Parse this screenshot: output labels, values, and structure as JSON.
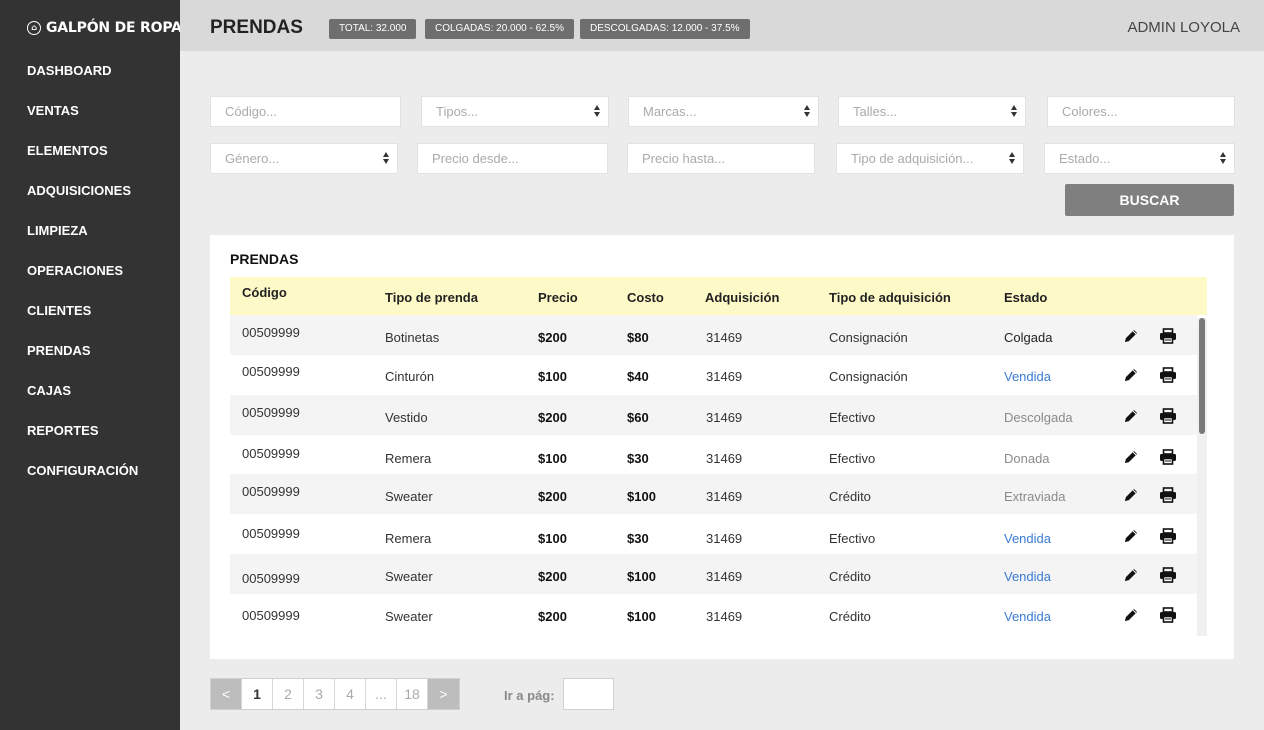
{
  "brand": {
    "name": "GALPÓN DE ROPA",
    "icon": "hanger-logo-icon"
  },
  "sidebar": {
    "items": [
      {
        "label": "DASHBOARD"
      },
      {
        "label": "VENTAS"
      },
      {
        "label": "ELEMENTOS"
      },
      {
        "label": "ADQUISICIONES"
      },
      {
        "label": "LIMPIEZA"
      },
      {
        "label": "OPERACIONES"
      },
      {
        "label": "CLIENTES"
      },
      {
        "label": "PRENDAS"
      },
      {
        "label": "CAJAS"
      },
      {
        "label": "REPORTES"
      },
      {
        "label": "CONFIGURACIÓN"
      }
    ]
  },
  "header": {
    "title": "PRENDAS",
    "badges": [
      "TOTAL: 32.000",
      "COLGADAS: 20.000 - 62.5%",
      "DESCOLGADAS: 12.000 - 37.5%"
    ],
    "user": "ADMIN LOYOLA"
  },
  "filters": {
    "codigo": "Código...",
    "tipos": "Tipos...",
    "marcas": "Marcas...",
    "talles": "Talles...",
    "colores": "Colores...",
    "genero": "Género...",
    "precio_desde": "Precio desde...",
    "precio_hasta": "Precio hasta...",
    "tipo_adquisicion": "Tipo de adquisición...",
    "estado": "Estado...",
    "buscar": "BUSCAR"
  },
  "table": {
    "title": "PRENDAS",
    "columns": [
      "Código",
      "Tipo de prenda",
      "Precio",
      "Costo",
      "Adquisición",
      "Tipo de adquisición",
      "Estado"
    ],
    "rows": [
      {
        "codigo": "00509999",
        "tipo": "Botinetas",
        "precio": "$200",
        "costo": "$80",
        "adquisicion": "31469",
        "tipo_adq": "Consignación",
        "estado": "Colgada",
        "estado_style": "neutral"
      },
      {
        "codigo": "00509999",
        "tipo": "Cinturón",
        "precio": "$100",
        "costo": "$40",
        "adquisicion": "31469",
        "tipo_adq": "Consignación",
        "estado": "Vendida",
        "estado_style": "link"
      },
      {
        "codigo": "00509999",
        "tipo": "Vestido",
        "precio": "$200",
        "costo": "$60",
        "adquisicion": "31469",
        "tipo_adq": "Efectivo",
        "estado": "Descolgada",
        "estado_style": "muted"
      },
      {
        "codigo": "00509999",
        "tipo": "Remera",
        "precio": "$100",
        "costo": "$30",
        "adquisicion": "31469",
        "tipo_adq": "Efectivo",
        "estado": "Donada",
        "estado_style": "muted"
      },
      {
        "codigo": "00509999",
        "tipo": "Sweater",
        "precio": "$200",
        "costo": "$100",
        "adquisicion": "31469",
        "tipo_adq": "Crédito",
        "estado": "Extraviada",
        "estado_style": "muted"
      },
      {
        "codigo": "00509999",
        "tipo": "Remera",
        "precio": "$100",
        "costo": "$30",
        "adquisicion": "31469",
        "tipo_adq": "Efectivo",
        "estado": "Vendida",
        "estado_style": "link"
      },
      {
        "codigo": "00509999",
        "tipo": "Sweater",
        "precio": "$200",
        "costo": "$100",
        "adquisicion": "31469",
        "tipo_adq": "Crédito",
        "estado": "Vendida",
        "estado_style": "link"
      },
      {
        "codigo": "00509999",
        "tipo": "Sweater",
        "precio": "$200",
        "costo": "$100",
        "adquisicion": "31469",
        "tipo_adq": "Crédito",
        "estado": "Vendida",
        "estado_style": "link"
      }
    ],
    "row_actions": [
      "pencil-icon",
      "printer-icon"
    ]
  },
  "pagination": {
    "prev": "<",
    "pages": [
      "1",
      "2",
      "3",
      "4",
      "...",
      "18"
    ],
    "current": "1",
    "next": ">",
    "goto_label": "Ir a pág:"
  },
  "colors": {
    "sidebar_bg": "#333333",
    "header_bg": "#d9d9d9",
    "table_header_bg": "#fefac8",
    "link": "#3a7bd5",
    "badge_bg": "#6e6e6e",
    "button_bg": "#7f7f7f"
  }
}
